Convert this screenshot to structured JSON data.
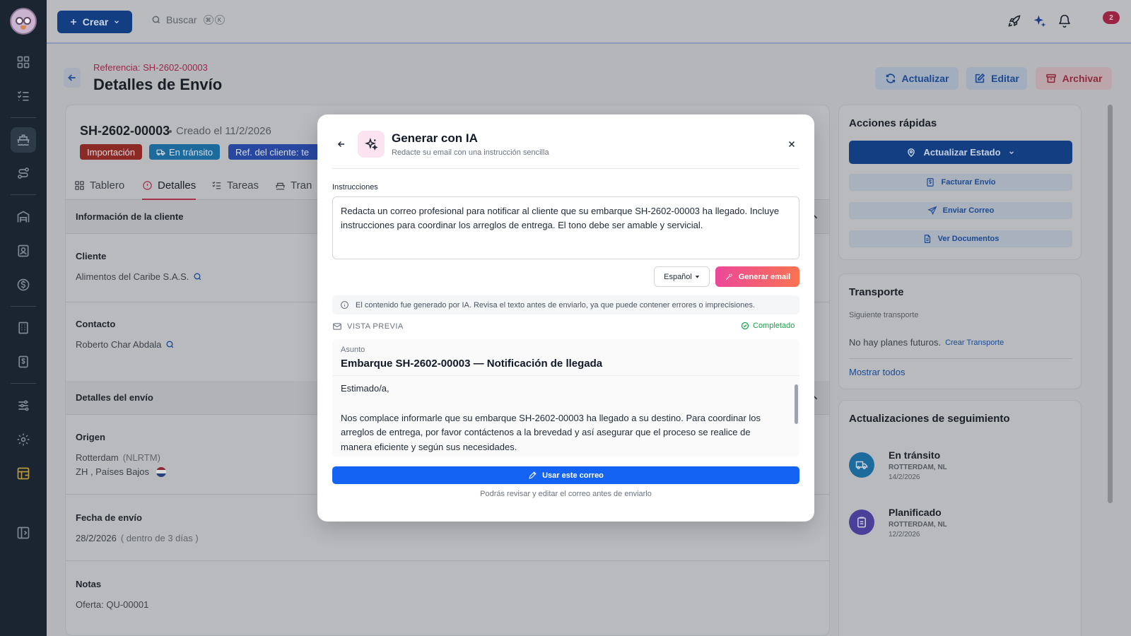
{
  "topbar": {
    "create_label": "Crear",
    "search_placeholder": "Buscar",
    "kbd_cmd": "⌘",
    "kbd_k": "K",
    "notifications_count": "2"
  },
  "page": {
    "reference": "Referencia: SH-2602-00003",
    "title": "Detalles de Envío",
    "actions": {
      "update": "Actualizar",
      "edit": "Editar",
      "archive": "Archivar"
    }
  },
  "shipment": {
    "id": "SH-2602-00003",
    "created": "Creado el 11/2/2026",
    "tags": {
      "type": "Importación",
      "status": "En tránsito",
      "client_ref": "Ref. del cliente: te"
    }
  },
  "tabs": [
    "Tablero",
    "Detalles",
    "Tareas",
    "Tran"
  ],
  "client_section": {
    "title": "Información de la cliente",
    "client_label": "Cliente",
    "client_value": "Alimentos del Caribe S.A.S.",
    "contact_label": "Contacto",
    "contact_value": "Roberto Char Abdala"
  },
  "shipping_section": {
    "title": "Detalles del envío",
    "origin_label": "Origen",
    "origin_city": "Rotterdam",
    "origin_code": "(NLRTM)",
    "origin_region": "ZH , Países Bajos",
    "date_label": "Fecha de envío",
    "date_value": "28/2/2026",
    "date_relative": "( dentro de 3 días )",
    "notes_label": "Notas",
    "notes_value": "Oferta: QU-00001"
  },
  "quick_actions": {
    "title": "Acciones rápidas",
    "update_status": "Actualizar Estado",
    "invoice": "Facturar Envío",
    "send_mail": "Enviar Correo",
    "documents": "Ver Documentos"
  },
  "transport": {
    "title": "Transporte",
    "next_label": "Siguiente transporte",
    "no_plans": "No hay planes futuros.",
    "create_link": "Crear Transporte",
    "show_all": "Mostrar todos"
  },
  "tracking": {
    "title": "Actualizaciones de seguimiento",
    "items": [
      {
        "status": "En tránsito",
        "location": "ROTTERDAM, NL",
        "date": "14/2/2026",
        "color": "#1d6b9c"
      },
      {
        "status": "Planificado",
        "location": "ROTTERDAM, NL",
        "date": "12/2/2026",
        "color": "#4a3f99"
      }
    ]
  },
  "modal": {
    "title": "Generar con IA",
    "subtitle": "Redacte su email con una instrucción sencilla",
    "instructions_label": "Instrucciones",
    "instructions_value": "Redacta un correo profesional para notificar al cliente que su embarque SH-2602-00003 ha llegado. Incluye instrucciones para coordinar los arreglos de entrega. El tono debe ser amable y servicial.",
    "language": "Español",
    "generate_label": "Generar email",
    "notice": "El contenido fue generado por IA. Revisa el texto antes de enviarlo, ya que puede contener errores o imprecisiones.",
    "preview_label": "VISTA PREVIA",
    "completed_label": "Completado",
    "subject_label": "Asunto",
    "subject_value": "Embarque SH-2602-00003 — Notificación de llegada",
    "greeting": "Estimado/a,",
    "body": "Nos complace informarle que su embarque SH-2602-00003 ha llegado a su destino. Para coordinar los arreglos de entrega, por favor contáctenos a la brevedad y así asegurar que el proceso se realice de manera eficiente y según sus necesidades.",
    "use_label": "Usar este correo",
    "footer": "Podrás revisar y editar el correo antes de enviarlo"
  },
  "colors": {
    "primary": "#1463f3",
    "ai_gradient_start": "#ec4899",
    "ai_gradient_end": "#f97352",
    "completed": "#16a34a"
  }
}
